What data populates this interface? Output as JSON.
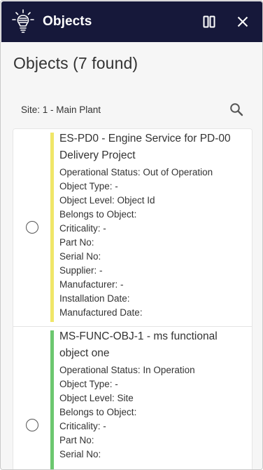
{
  "header": {
    "title": "Objects",
    "logo_icon": "lightbulb-logo-icon",
    "columns_icon": "columns-icon",
    "close_icon": "close-icon",
    "background": "#16183a"
  },
  "page": {
    "title": "Objects (7 found)"
  },
  "filter": {
    "site_label": "Site: 1 - Main Plant",
    "search_icon": "search-icon"
  },
  "objects": [
    {
      "title": "ES-PD0 - Engine Service for PD-00 Delivery Project",
      "status_color": "#f0e668",
      "selected": false,
      "fields": [
        "Operational Status: Out of Operation",
        "Object Type: -",
        "Object Level: Object Id",
        "Belongs to Object:",
        "Criticality: -",
        "Part No:",
        "Serial No:",
        "Supplier: -",
        "Manufacturer: -",
        "Installation Date:",
        "Manufactured Date:"
      ]
    },
    {
      "title": "MS-FUNC-OBJ-1 - ms functional object one",
      "status_color": "#6cc76f",
      "selected": false,
      "fields": [
        "Operational Status: In Operation",
        "Object Type: -",
        "Object Level: Site",
        "Belongs to Object:",
        "Criticality: -",
        "Part No:",
        "Serial No:"
      ]
    }
  ]
}
